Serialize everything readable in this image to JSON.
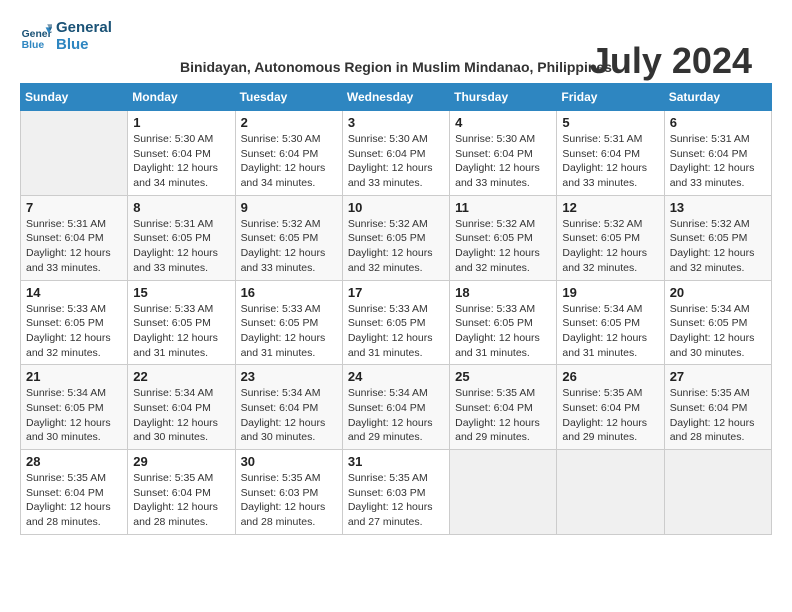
{
  "header": {
    "logo_line1": "General",
    "logo_line2": "Blue",
    "month_year": "July 2024",
    "subtitle": "Binidayan, Autonomous Region in Muslim Mindanao, Philippines"
  },
  "weekdays": [
    "Sunday",
    "Monday",
    "Tuesday",
    "Wednesday",
    "Thursday",
    "Friday",
    "Saturday"
  ],
  "weeks": [
    [
      {
        "day": "",
        "info": ""
      },
      {
        "day": "1",
        "info": "Sunrise: 5:30 AM\nSunset: 6:04 PM\nDaylight: 12 hours\nand 34 minutes."
      },
      {
        "day": "2",
        "info": "Sunrise: 5:30 AM\nSunset: 6:04 PM\nDaylight: 12 hours\nand 34 minutes."
      },
      {
        "day": "3",
        "info": "Sunrise: 5:30 AM\nSunset: 6:04 PM\nDaylight: 12 hours\nand 33 minutes."
      },
      {
        "day": "4",
        "info": "Sunrise: 5:30 AM\nSunset: 6:04 PM\nDaylight: 12 hours\nand 33 minutes."
      },
      {
        "day": "5",
        "info": "Sunrise: 5:31 AM\nSunset: 6:04 PM\nDaylight: 12 hours\nand 33 minutes."
      },
      {
        "day": "6",
        "info": "Sunrise: 5:31 AM\nSunset: 6:04 PM\nDaylight: 12 hours\nand 33 minutes."
      }
    ],
    [
      {
        "day": "7",
        "info": "Sunrise: 5:31 AM\nSunset: 6:04 PM\nDaylight: 12 hours\nand 33 minutes."
      },
      {
        "day": "8",
        "info": "Sunrise: 5:31 AM\nSunset: 6:05 PM\nDaylight: 12 hours\nand 33 minutes."
      },
      {
        "day": "9",
        "info": "Sunrise: 5:32 AM\nSunset: 6:05 PM\nDaylight: 12 hours\nand 33 minutes."
      },
      {
        "day": "10",
        "info": "Sunrise: 5:32 AM\nSunset: 6:05 PM\nDaylight: 12 hours\nand 32 minutes."
      },
      {
        "day": "11",
        "info": "Sunrise: 5:32 AM\nSunset: 6:05 PM\nDaylight: 12 hours\nand 32 minutes."
      },
      {
        "day": "12",
        "info": "Sunrise: 5:32 AM\nSunset: 6:05 PM\nDaylight: 12 hours\nand 32 minutes."
      },
      {
        "day": "13",
        "info": "Sunrise: 5:32 AM\nSunset: 6:05 PM\nDaylight: 12 hours\nand 32 minutes."
      }
    ],
    [
      {
        "day": "14",
        "info": "Sunrise: 5:33 AM\nSunset: 6:05 PM\nDaylight: 12 hours\nand 32 minutes."
      },
      {
        "day": "15",
        "info": "Sunrise: 5:33 AM\nSunset: 6:05 PM\nDaylight: 12 hours\nand 31 minutes."
      },
      {
        "day": "16",
        "info": "Sunrise: 5:33 AM\nSunset: 6:05 PM\nDaylight: 12 hours\nand 31 minutes."
      },
      {
        "day": "17",
        "info": "Sunrise: 5:33 AM\nSunset: 6:05 PM\nDaylight: 12 hours\nand 31 minutes."
      },
      {
        "day": "18",
        "info": "Sunrise: 5:33 AM\nSunset: 6:05 PM\nDaylight: 12 hours\nand 31 minutes."
      },
      {
        "day": "19",
        "info": "Sunrise: 5:34 AM\nSunset: 6:05 PM\nDaylight: 12 hours\nand 31 minutes."
      },
      {
        "day": "20",
        "info": "Sunrise: 5:34 AM\nSunset: 6:05 PM\nDaylight: 12 hours\nand 30 minutes."
      }
    ],
    [
      {
        "day": "21",
        "info": "Sunrise: 5:34 AM\nSunset: 6:05 PM\nDaylight: 12 hours\nand 30 minutes."
      },
      {
        "day": "22",
        "info": "Sunrise: 5:34 AM\nSunset: 6:04 PM\nDaylight: 12 hours\nand 30 minutes."
      },
      {
        "day": "23",
        "info": "Sunrise: 5:34 AM\nSunset: 6:04 PM\nDaylight: 12 hours\nand 30 minutes."
      },
      {
        "day": "24",
        "info": "Sunrise: 5:34 AM\nSunset: 6:04 PM\nDaylight: 12 hours\nand 29 minutes."
      },
      {
        "day": "25",
        "info": "Sunrise: 5:35 AM\nSunset: 6:04 PM\nDaylight: 12 hours\nand 29 minutes."
      },
      {
        "day": "26",
        "info": "Sunrise: 5:35 AM\nSunset: 6:04 PM\nDaylight: 12 hours\nand 29 minutes."
      },
      {
        "day": "27",
        "info": "Sunrise: 5:35 AM\nSunset: 6:04 PM\nDaylight: 12 hours\nand 28 minutes."
      }
    ],
    [
      {
        "day": "28",
        "info": "Sunrise: 5:35 AM\nSunset: 6:04 PM\nDaylight: 12 hours\nand 28 minutes."
      },
      {
        "day": "29",
        "info": "Sunrise: 5:35 AM\nSunset: 6:04 PM\nDaylight: 12 hours\nand 28 minutes."
      },
      {
        "day": "30",
        "info": "Sunrise: 5:35 AM\nSunset: 6:03 PM\nDaylight: 12 hours\nand 28 minutes."
      },
      {
        "day": "31",
        "info": "Sunrise: 5:35 AM\nSunset: 6:03 PM\nDaylight: 12 hours\nand 27 minutes."
      },
      {
        "day": "",
        "info": ""
      },
      {
        "day": "",
        "info": ""
      },
      {
        "day": "",
        "info": ""
      }
    ]
  ]
}
